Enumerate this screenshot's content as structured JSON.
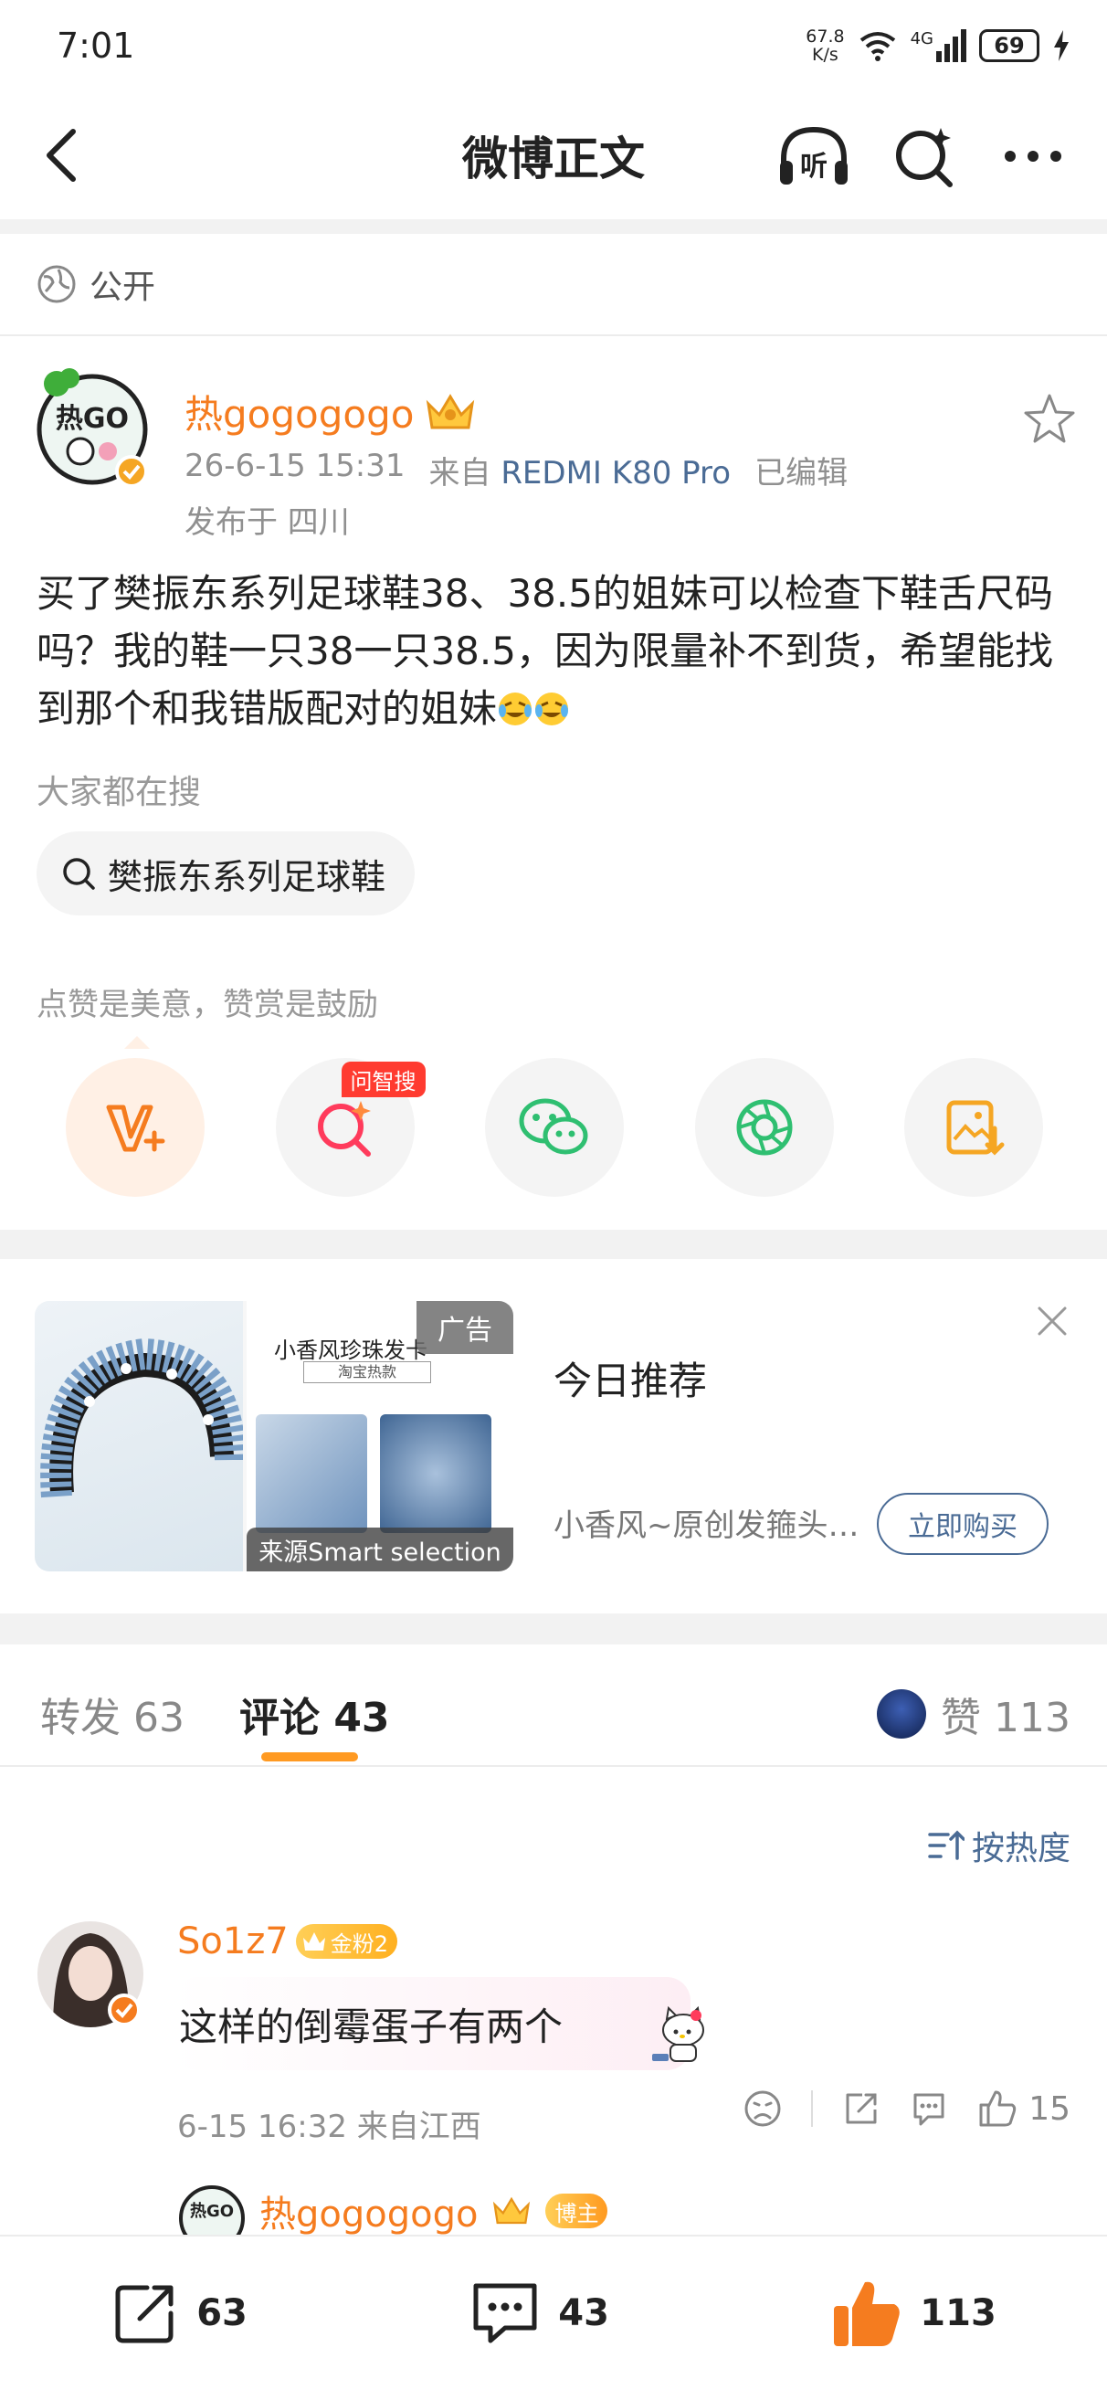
{
  "status": {
    "time": "7:01",
    "net_speed_value": "67.8",
    "net_speed_unit": "K/s",
    "network": "4G",
    "battery": "69"
  },
  "nav": {
    "title": "微博正文",
    "listen_label": "听"
  },
  "visibility": {
    "label": "公开"
  },
  "post": {
    "author": "热gogogogo",
    "time": "26-6-15 15:31",
    "source_prefix": "来自",
    "device": "REDMI K80 Pro",
    "edited": "已编辑",
    "location": "发布于 四川",
    "text": "买了樊振东系列足球鞋38、38.5的姐妹可以检查下鞋舌尺码吗？我的鞋一只38一只38.5，因为限量补不到货，希望能找到那个和我错版配对的姐妹"
  },
  "search": {
    "label": "大家都在搜",
    "query": "樊振东系列足球鞋"
  },
  "actions": {
    "hint": "点赞是美意，赞赏是鼓励",
    "ai_badge": "问智搜",
    "accent_color": "#f57c1f"
  },
  "ad": {
    "badge": "广告",
    "image_headline": "小香风珍珠发卡",
    "image_tag": "淘宝热款",
    "source": "来源Smart selection",
    "title": "今日推荐",
    "description": "小香风~原创发箍头饰珍珠发卡",
    "buy_button": "立即购买"
  },
  "tabs": {
    "repost": "转发 63",
    "comments": "评论 43",
    "likes": "赞 113"
  },
  "sort": {
    "label": "按热度"
  },
  "comment": {
    "author": "So1z7",
    "fan_level_badge": "金粉2",
    "text": "这样的倒霉蛋子有两个",
    "time_location": "6-15 16:32 来自江西",
    "likes": "15"
  },
  "reply": {
    "author": "热gogogogo",
    "badge": "博主"
  },
  "bottom_bar": {
    "reposts": "63",
    "comments": "43",
    "likes": "113"
  }
}
